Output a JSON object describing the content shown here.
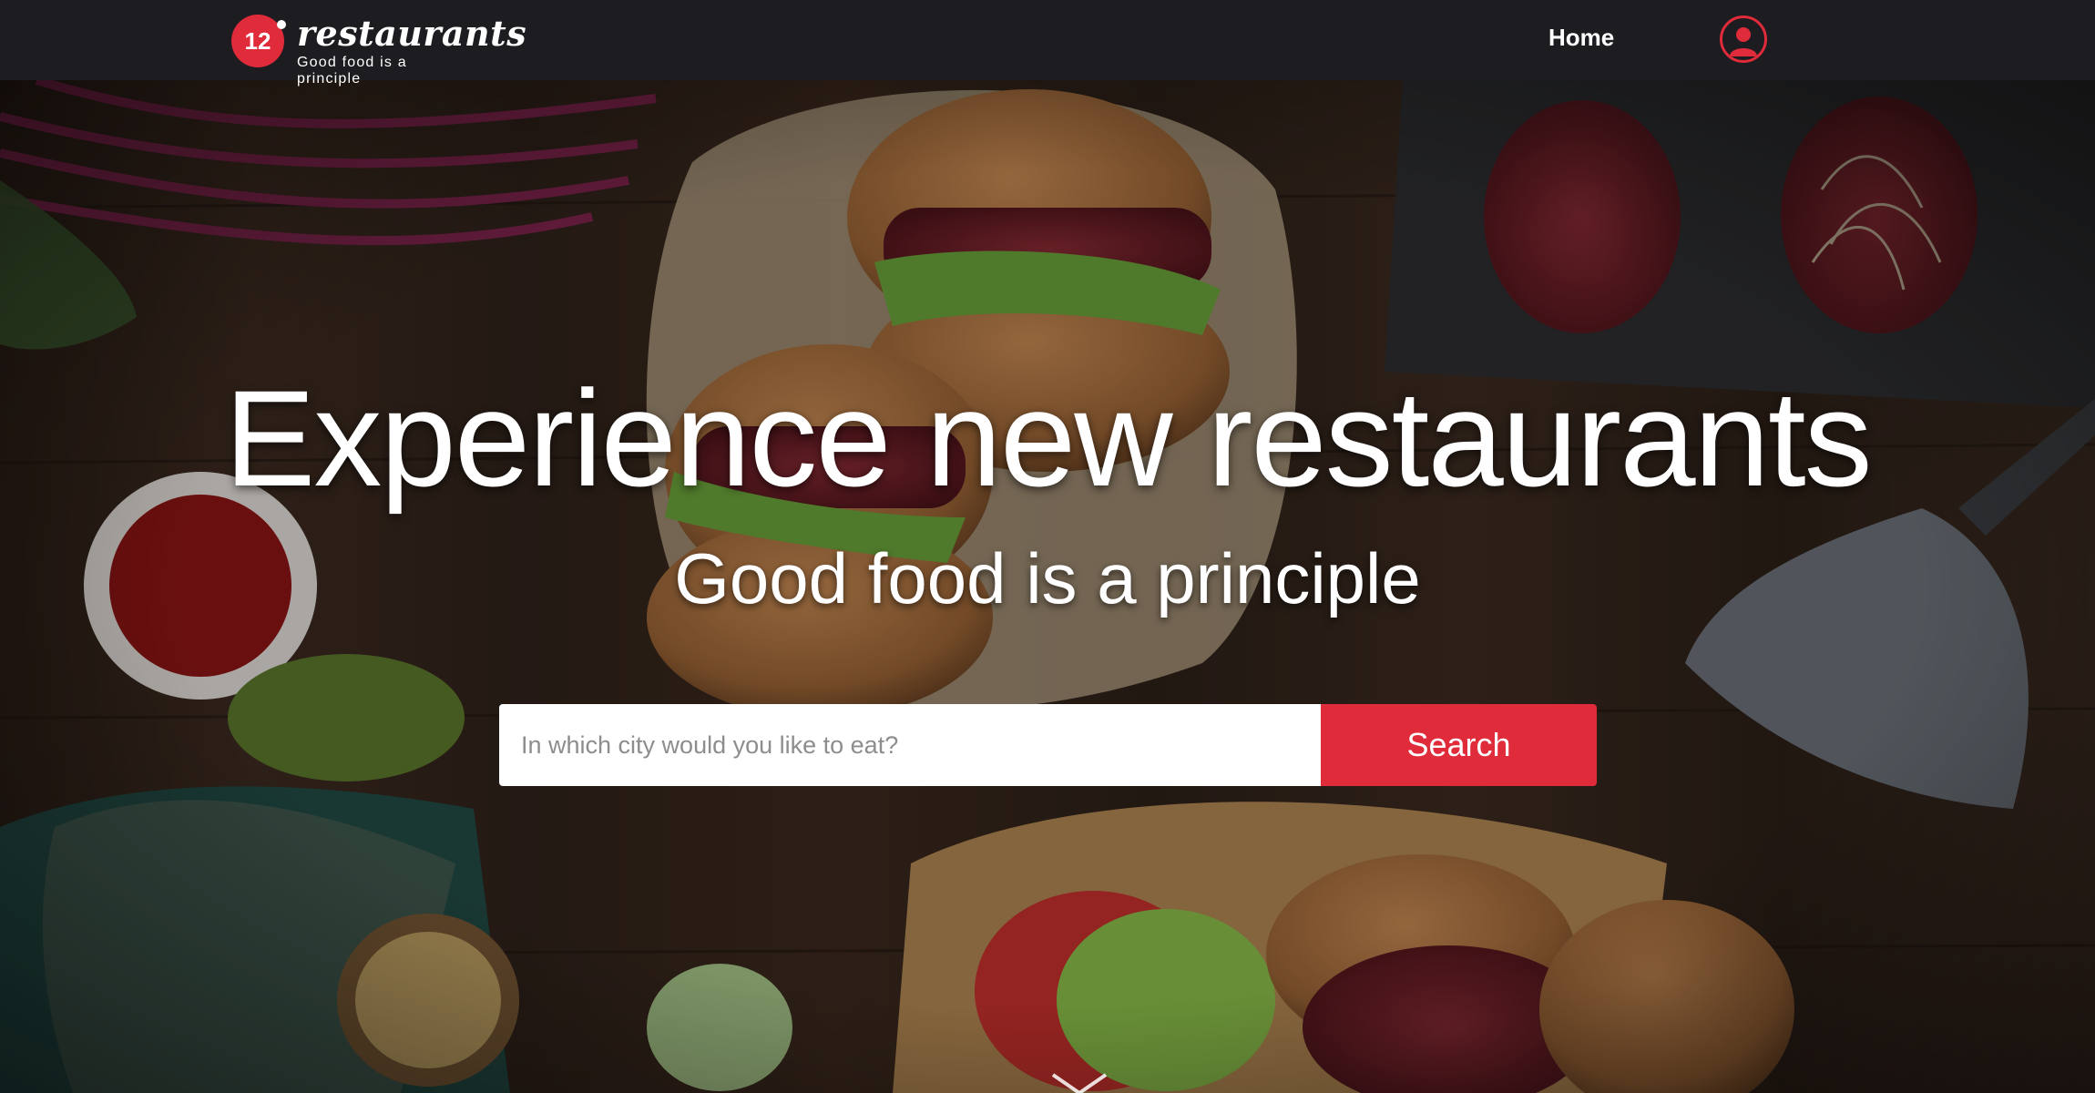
{
  "header": {
    "logo_number": "12",
    "logo_word": "restaurants",
    "logo_tagline": "Good food is a principle",
    "nav_home": "Home",
    "account_icon": "user-icon"
  },
  "hero": {
    "title": "Experience new restaurants",
    "subtitle": "Good food is a principle",
    "background": "food-photo-burgers-on-wooden-table"
  },
  "search": {
    "placeholder": "In which city would you like to eat?",
    "value": "",
    "button_label": "Search"
  },
  "scroll_icon": "chevron-down-icon",
  "colors": {
    "accent": "#e02b3b",
    "header_bg": "#1d1c20",
    "text": "#ffffff"
  }
}
